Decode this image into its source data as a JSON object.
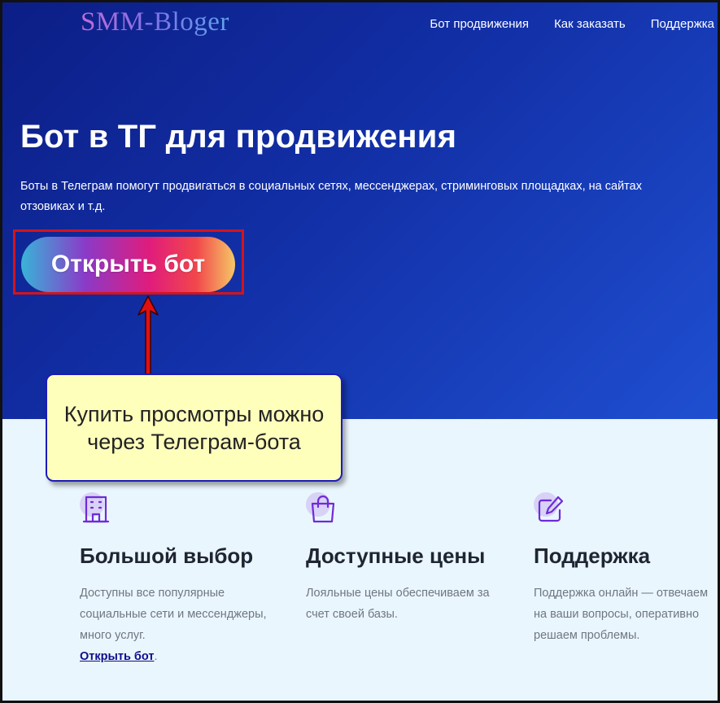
{
  "header": {
    "logo": "SMM-Bloger",
    "nav": [
      "Бот продвижения",
      "Как заказать",
      "Поддержка"
    ]
  },
  "hero": {
    "title": "Бот в ТГ для продвижения",
    "description": "Боты в Телеграм помогут продвигаться в социальных сетях, мессенджерах, стриминговых площадках, на сайтах отзовиках и т.д.",
    "button_label": "Открыть бот"
  },
  "callout": {
    "text": "Купить просмотры можно через Телеграм-бота"
  },
  "features": [
    {
      "icon": "building-icon",
      "title": "Большой выбор",
      "text": "Доступны все популярные социальные сети и мессенджеры, много услуг.",
      "link": "Открыть бот",
      "link_suffix": "."
    },
    {
      "icon": "shopping-bag-icon",
      "title": "Доступные цены",
      "text": "Лояльные цены обеспечиваем за счет своей базы."
    },
    {
      "icon": "edit-icon",
      "title": "Поддержка",
      "text": "Поддержка онлайн — отвечаем на ваши вопросы, оперативно решаем проблемы."
    }
  ],
  "colors": {
    "hero_start": "#0c1e86",
    "hero_end": "#1f4fd1",
    "highlight": "#d3141b",
    "callout_bg": "#ffffbc",
    "icon_purple": "#6f2bd9"
  }
}
